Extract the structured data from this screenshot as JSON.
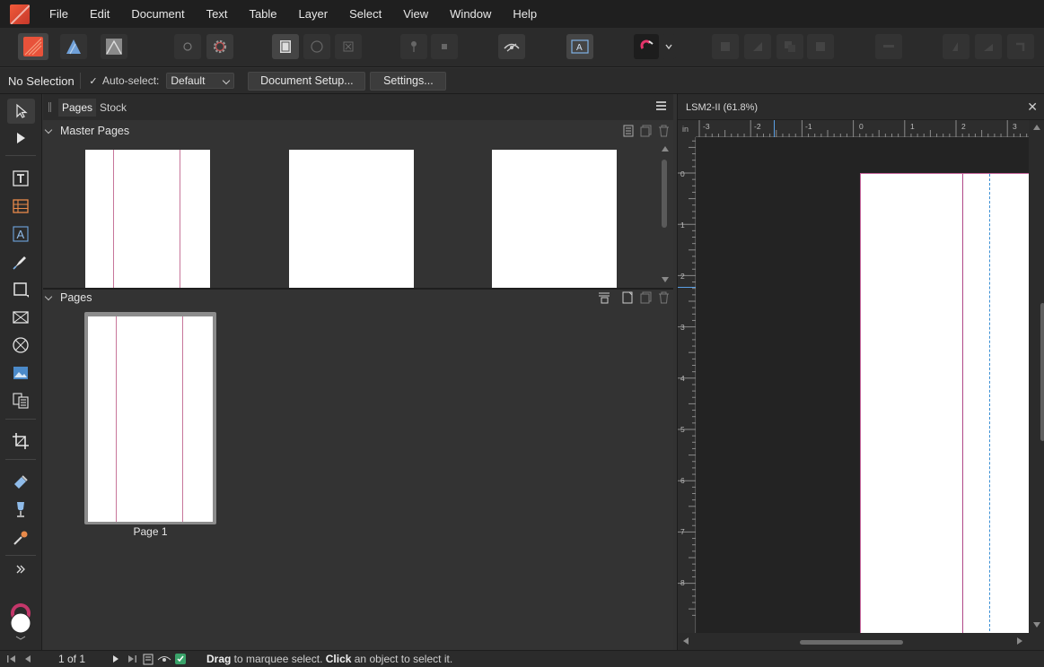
{
  "menu": [
    "File",
    "Edit",
    "Document",
    "Text",
    "Table",
    "Layer",
    "Select",
    "View",
    "Window",
    "Help"
  ],
  "context_bar": {
    "selection": "No Selection",
    "auto_select_label": "Auto-select:",
    "auto_select_value": "Default",
    "document_setup": "Document Setup...",
    "settings": "Settings..."
  },
  "panel": {
    "tabs": [
      "Pages",
      "Stock"
    ],
    "master_pages_title": "Master Pages",
    "pages_title": "Pages",
    "page1_label": "Page 1"
  },
  "document": {
    "title": "LSM2-II (61.8%)",
    "ruler_unit": "in",
    "h_ruler_labels": [
      "-3",
      "-2",
      "-1",
      "0",
      "1",
      "2",
      "3"
    ],
    "v_ruler_labels": [
      "0",
      "1",
      "2",
      "3",
      "4",
      "5",
      "6",
      "7",
      "8"
    ]
  },
  "status": {
    "page_count": "1 of 1",
    "hint_drag": "Drag",
    "hint_mid": " to marquee select. ",
    "hint_click": "Click",
    "hint_end": " an object to select it."
  },
  "colors": {
    "accent": "#e8523a",
    "guide": "#c7769a",
    "panel_bg": "#333333",
    "canvas_bg": "#232323"
  }
}
